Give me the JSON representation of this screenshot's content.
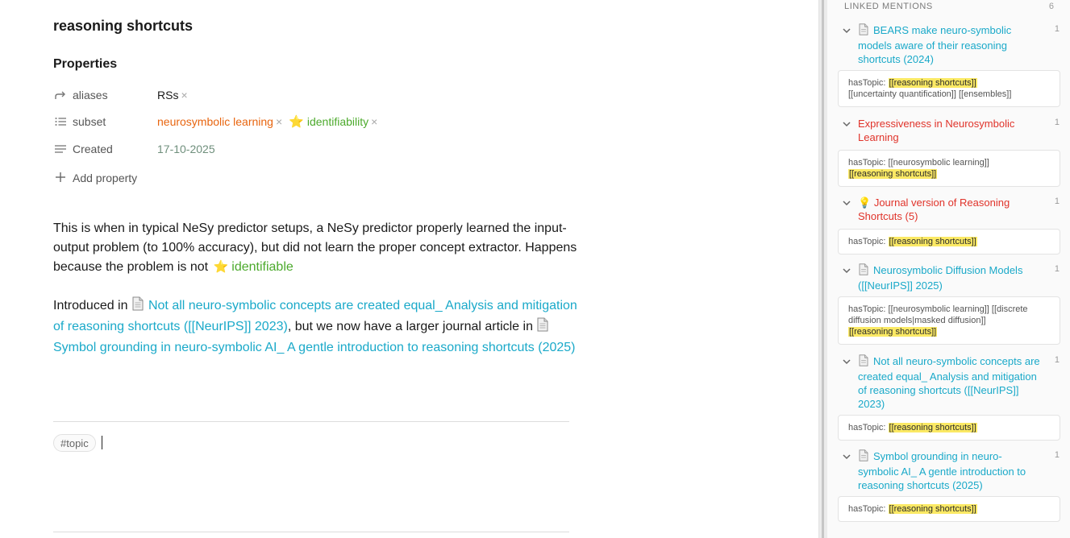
{
  "note": {
    "title": "reasoning shortcuts",
    "properties_heading": "Properties",
    "properties": {
      "aliases": {
        "label": "aliases",
        "value": "RSs",
        "remove_glyph": "×"
      },
      "subset": {
        "label": "subset",
        "values": [
          {
            "text": "neurosymbolic learning",
            "remove_glyph": "×"
          },
          {
            "text": "identifiability",
            "emoji": "⭐",
            "remove_glyph": "×"
          }
        ]
      },
      "created": {
        "label": "Created",
        "value": "17-10-2025"
      }
    },
    "add_property_label": "Add property",
    "paragraph1": {
      "text_before": "This is when in typical NeSy predictor setups, a NeSy predictor properly learned the input-output problem (to 100% accuracy), but did not learn the proper concept extractor. Happens because the problem is not",
      "link_emoji": "⭐",
      "link_text": "identifiable"
    },
    "paragraph2": {
      "text_before": "Introduced in",
      "link1": "Not all neuro-symbolic concepts are created equal_ Analysis and mitigation of reasoning shortcuts ([[NeurIPS]] 2023)",
      "text_middle": ", but we now have a larger journal article in",
      "link2": "Symbol grounding in neuro-symbolic AI_ A gentle introduction to reasoning shortcuts (2025)"
    },
    "tag": "#topic"
  },
  "sidebar": {
    "heading": "LINKED MENTIONS",
    "count": "6",
    "mentions": [
      {
        "title": "BEARS make neuro-symbolic models aware of their reasoning shortcuts (2024)",
        "count": "1",
        "card_prefix": "hasTopic: ",
        "card_highlight": "[[reasoning shortcuts]]",
        "card_rest": "[[uncertainty quantification]] [[ensembles]]"
      },
      {
        "title": "Expressiveness in Neurosymbolic Learning",
        "count": "1",
        "card_prefix": "hasTopic: [[neurosymbolic learning]]",
        "card_highlight": "[[reasoning shortcuts]]"
      },
      {
        "emoji": "💡",
        "title": "Journal version of Reasoning Shortcuts (5)",
        "count": "1",
        "card_prefix": "hasTopic: ",
        "card_highlight": "[[reasoning shortcuts]]"
      },
      {
        "title": "Neurosymbolic Diffusion Models ([[NeurIPS]] 2025)",
        "count": "1",
        "card_prefix": "hasTopic: [[neurosymbolic learning]] [[discrete diffusion models|masked diffusion]]",
        "card_highlight": "[[reasoning shortcuts]]"
      },
      {
        "title": "Not all neuro-symbolic concepts are created equal_ Analysis and mitigation of reasoning shortcuts ([[NeurIPS]] 2023)",
        "count": "1",
        "card_prefix": "hasTopic: ",
        "card_highlight": "[[reasoning shortcuts]]"
      },
      {
        "title": "Symbol grounding in neuro-symbolic AI_ A gentle introduction to reasoning shortcuts (2025)",
        "count": "1",
        "card_prefix": "hasTopic: ",
        "card_highlight": "[[reasoning shortcuts]]"
      }
    ]
  },
  "colors": {
    "link": "#1aa9c9",
    "tag_orange": "#e8650f",
    "tag_green": "#4caa2c",
    "mention_red": "#e0332a",
    "highlight": "#fbe964"
  },
  "icons": {
    "aliases": "corner-up-right-arrow-icon",
    "subset": "list-icon",
    "created": "text-lines-icon",
    "add": "plus-icon",
    "chevron": "chevron-down-icon",
    "document": "document-icon",
    "bulb": "lightbulb-icon",
    "star": "star-icon"
  }
}
